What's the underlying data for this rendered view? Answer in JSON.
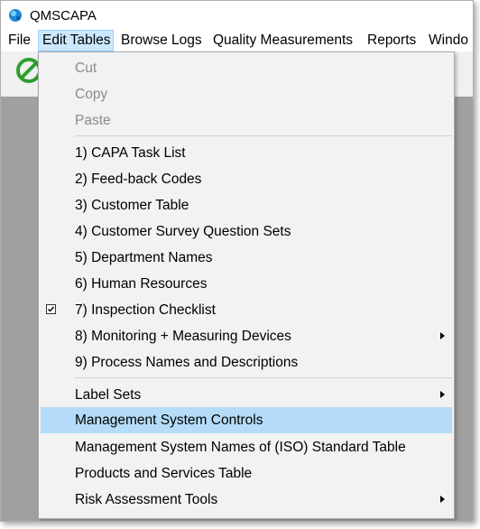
{
  "window": {
    "title": "QMSCAPA"
  },
  "menubar": {
    "items": [
      {
        "label": "File"
      },
      {
        "label": "Edit Tables"
      },
      {
        "label": "Browse Logs"
      },
      {
        "label": "Quality Measurements"
      },
      {
        "label": "Reports"
      },
      {
        "label": "Windo"
      }
    ]
  },
  "dropdown": {
    "items": [
      {
        "label": "Cut",
        "enabled": false
      },
      {
        "label": "Copy",
        "enabled": false
      },
      {
        "label": "Paste",
        "enabled": false
      },
      {
        "label": "1) CAPA Task List"
      },
      {
        "label": "2) Feed-back Codes"
      },
      {
        "label": "3) Customer Table"
      },
      {
        "label": "4) Customer Survey Question Sets"
      },
      {
        "label": "5) Department Names"
      },
      {
        "label": "6) Human Resources"
      },
      {
        "label": "7) Inspection Checklist",
        "checked": true
      },
      {
        "label": "8) Monitoring + Measuring Devices",
        "submenu": true
      },
      {
        "label": "9) Process Names and Descriptions"
      },
      {
        "label": "Label Sets",
        "submenu": true
      },
      {
        "label": "Management System Controls",
        "highlighted": true
      },
      {
        "label": "Management System Names of (ISO) Standard Table"
      },
      {
        "label": "Products and Services Table"
      },
      {
        "label": "Risk Assessment Tools",
        "submenu": true
      }
    ]
  },
  "colors": {
    "menu_highlight": "#b4dcf8",
    "menubar_active": "#cce8ff",
    "workspace": "#a0a0a0",
    "disabled_text": "#8a8a8a"
  },
  "icons": {
    "app": "qmscapa-app-icon",
    "toolbar": "green-cancel-icon",
    "check": "checkbox-checked-icon",
    "submenu": "submenu-arrow-icon"
  }
}
